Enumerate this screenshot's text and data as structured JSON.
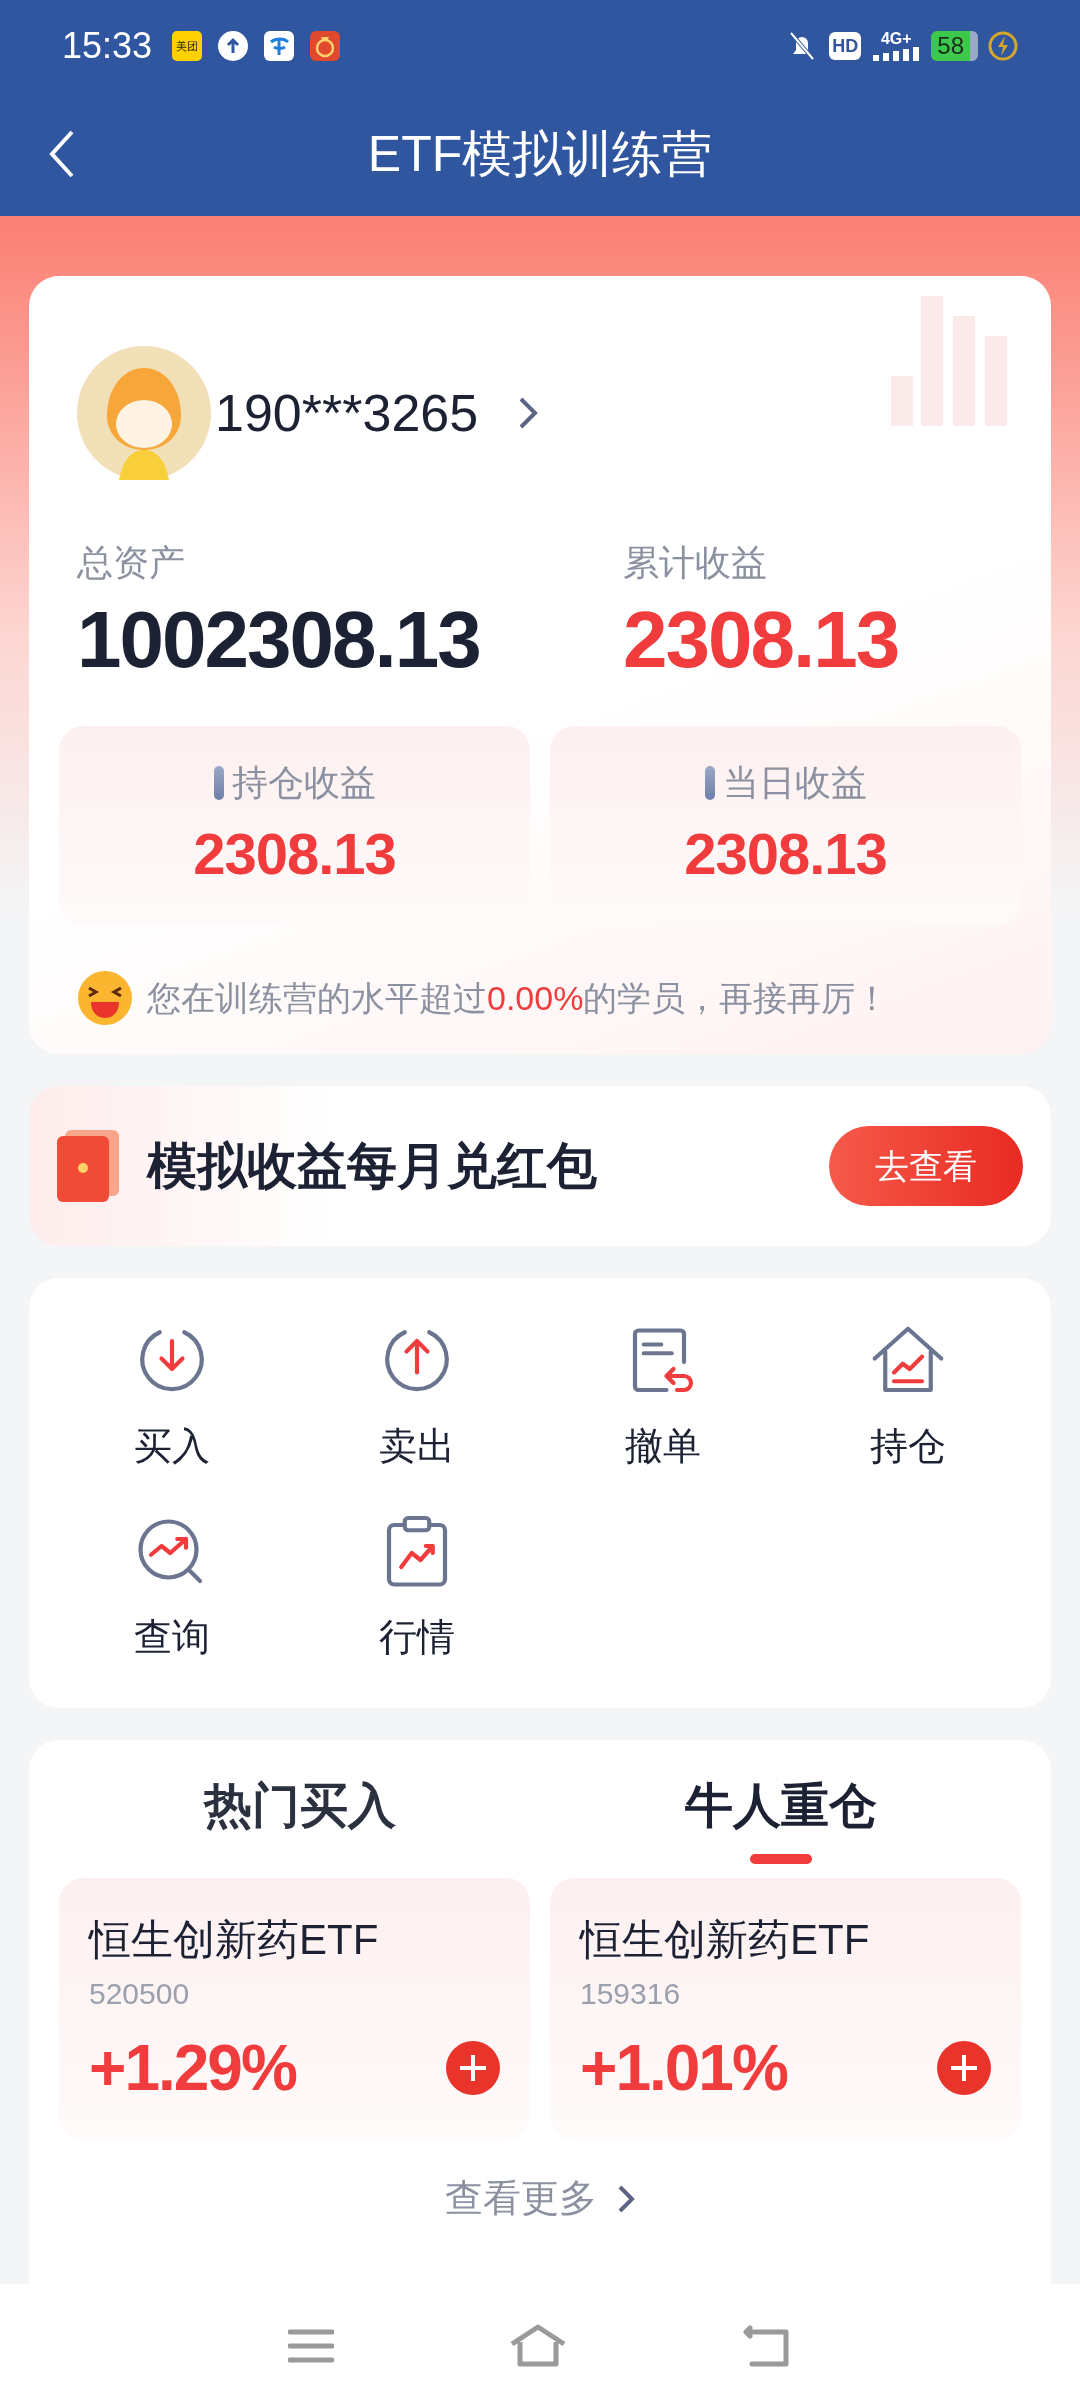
{
  "status_bar": {
    "time": "15:33",
    "app_badge": "美团",
    "network": "4G+",
    "hd": "HD",
    "battery": "58"
  },
  "header": {
    "title": "ETF模拟训练营"
  },
  "account": {
    "phone": "190***3265",
    "total_label": "总资产",
    "total_value": "1002308.13",
    "profit_label": "累计收益",
    "profit_value": "2308.13",
    "sub_cards": [
      {
        "label": "持仓收益",
        "value": "2308.13"
      },
      {
        "label": "当日收益",
        "value": "2308.13"
      }
    ],
    "message": {
      "before": "您在训练营的水平超过",
      "highlight": "0.00%",
      "after": "的学员，再接再厉！"
    }
  },
  "banner": {
    "title": "模拟收益每月兑红包",
    "button": "去查看"
  },
  "actions": [
    {
      "kind": "buy",
      "label": "买入"
    },
    {
      "kind": "sell",
      "label": "卖出"
    },
    {
      "kind": "cancel",
      "label": "撤单"
    },
    {
      "kind": "holdings",
      "label": "持仓"
    },
    {
      "kind": "query",
      "label": "查询"
    },
    {
      "kind": "market",
      "label": "行情"
    }
  ],
  "tabs": [
    {
      "label": "热门买入",
      "selected": false
    },
    {
      "label": "牛人重仓",
      "selected": true
    }
  ],
  "funds": [
    {
      "name": "恒生创新药ETF",
      "code": "520500",
      "change": "+1.29%"
    },
    {
      "name": "恒生创新药ETF",
      "code": "159316",
      "change": "+1.01%"
    }
  ],
  "more_link": "查看更多"
}
